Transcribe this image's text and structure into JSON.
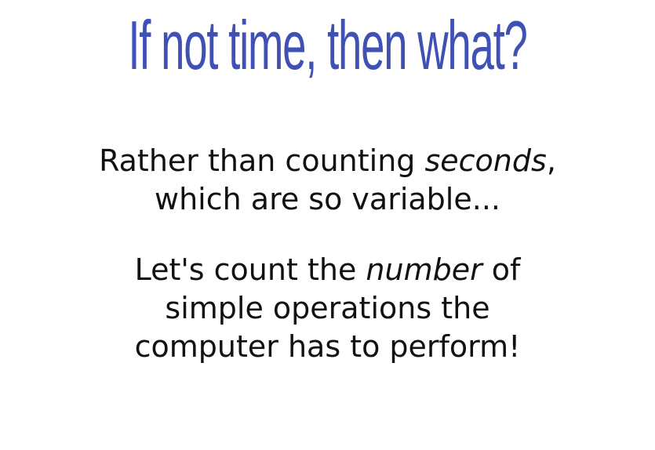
{
  "slide": {
    "title": "If not time, then what?",
    "paragraph1": {
      "line1_before": "Rather than counting ",
      "line1_em": "seconds",
      "line1_after": ",",
      "line2": "which are so variable..."
    },
    "paragraph2": {
      "line1_before": "Let's count the ",
      "line1_em": "number",
      "line1_after": " of",
      "line2": "simple operations the",
      "line3": "computer has to perform!"
    },
    "colors": {
      "title": "#3f51b5",
      "text": "#111111",
      "background": "#ffffff"
    }
  }
}
